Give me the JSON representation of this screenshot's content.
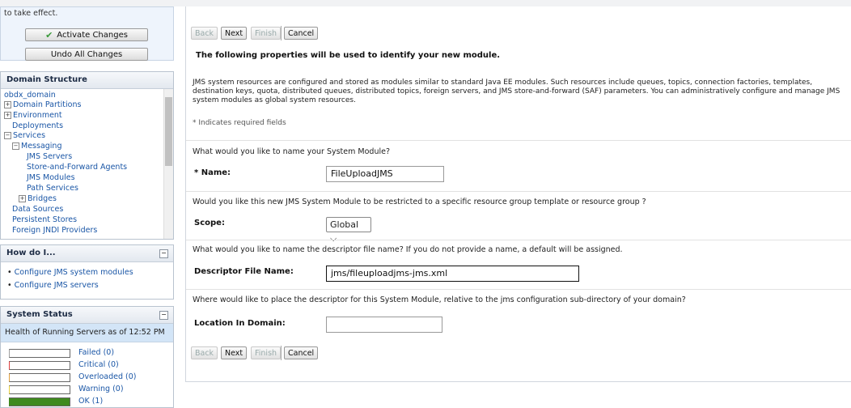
{
  "change_center": {
    "message": "to take effect.",
    "activate_label": "Activate Changes",
    "undo_label": "Undo All Changes"
  },
  "domain_structure": {
    "title": "Domain Structure",
    "nodes": {
      "root": "obdx_domain",
      "partitions": "Domain Partitions",
      "environment": "Environment",
      "deployments": "Deployments",
      "services": "Services",
      "messaging": "Messaging",
      "jms_servers": "JMS Servers",
      "saf_agents": "Store-and-Forward Agents",
      "jms_modules": "JMS Modules",
      "path_services": "Path Services",
      "bridges": "Bridges",
      "data_sources": "Data Sources",
      "persistent_stores": "Persistent Stores",
      "foreign_jndi": "Foreign JNDI Providers"
    }
  },
  "how_do_i": {
    "title": "How do I...",
    "links": [
      "Configure JMS system modules",
      "Configure JMS servers"
    ]
  },
  "system_status": {
    "title": "System Status",
    "health_text": "Health of Running Servers as of  12:52 PM",
    "rows": [
      {
        "label": "Failed (0)",
        "color": "#a0a0a0",
        "fill": 0
      },
      {
        "label": "Critical (0)",
        "color": "#e04040",
        "fill": 0
      },
      {
        "label": "Overloaded (0)",
        "color": "#e0a040",
        "fill": 0
      },
      {
        "label": "Warning (0)",
        "color": "#e8d040",
        "fill": 0
      },
      {
        "label": "OK (1)",
        "color": "#3f8a1e",
        "fill": 1
      }
    ]
  },
  "wizard": {
    "buttons": {
      "back": "Back",
      "next": "Next",
      "finish": "Finish",
      "cancel": "Cancel"
    },
    "heading": "The following properties will be used to identify your new module.",
    "description": "JMS system resources are configured and stored as modules similar to standard Java EE modules. Such resources include queues, topics, connection factories, templates, destination keys, quota, distributed queues, distributed topics, foreign servers, and JMS store-and-forward (SAF) parameters. You can administratively configure and manage JMS system modules as global system resources.",
    "required_note": "* Indicates required fields",
    "q_name": "What would you like to name your System Module?",
    "name_label": "* Name:",
    "name_value": "FileUploadJMS",
    "q_scope": "Would you like this new JMS System Module to be restricted to a specific resource group template or resource group ?",
    "scope_label": "Scope:",
    "scope_value": "Global",
    "q_descriptor": "What would you like to name the descriptor file name? If you do not provide a name, a default will be assigned.",
    "descriptor_label": "Descriptor File Name:",
    "descriptor_value": "jms/fileuploadjms-jms.xml",
    "q_location": "Where would like to place the descriptor for this System Module, relative to the jms configuration sub-directory of your domain?",
    "location_label": "Location In Domain:",
    "location_value": ""
  }
}
